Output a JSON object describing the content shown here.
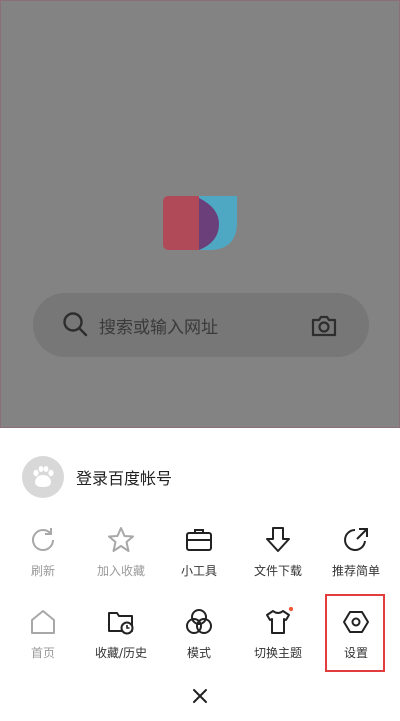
{
  "search": {
    "placeholder": "搜索或输入网址"
  },
  "account": {
    "login_label": "登录百度帐号"
  },
  "menu": {
    "row1": [
      {
        "label": "刷新",
        "icon": "refresh-icon"
      },
      {
        "label": "加入收藏",
        "icon": "star-icon"
      },
      {
        "label": "小工具",
        "icon": "toolbox-icon"
      },
      {
        "label": "文件下载",
        "icon": "download-icon"
      },
      {
        "label": "推荐简单",
        "icon": "share-icon"
      }
    ],
    "row2": [
      {
        "label": "首页",
        "icon": "home-icon"
      },
      {
        "label": "收藏/历史",
        "icon": "folder-history-icon"
      },
      {
        "label": "模式",
        "icon": "mode-icon"
      },
      {
        "label": "切换主题",
        "icon": "theme-shirt-icon"
      },
      {
        "label": "设置",
        "icon": "settings-icon"
      }
    ]
  },
  "colors": {
    "highlight": "#e23c3c",
    "dim_text": "#9a9a9a"
  }
}
